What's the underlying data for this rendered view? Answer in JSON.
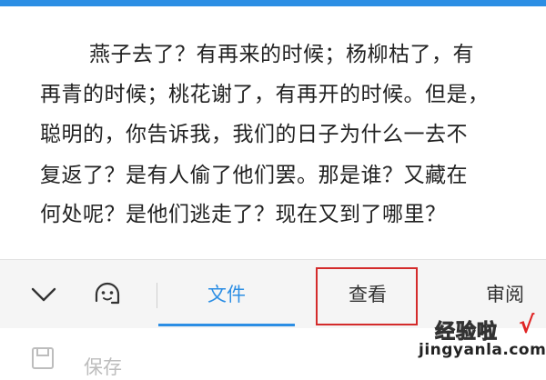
{
  "document": {
    "lines": [
      "燕子去了？有再来的时候；杨柳枯了，有",
      "再青的时候；桃花谢了，有再开的时候。但是，",
      "聪明的，你告诉我，我们的日子为什么一去不",
      "复返了？是有人偷了他们罢。那是谁？又藏在",
      "何处呢？是他们逃走了？现在又到了哪里？"
    ]
  },
  "toolbar": {
    "collapse_icon": "chevron-down-icon",
    "voice_icon": "voice-assistant-icon",
    "tabs": [
      {
        "label": "文件",
        "active": true
      },
      {
        "label": "查看",
        "active": false,
        "highlighted": true
      },
      {
        "label": "审阅",
        "active": false
      }
    ],
    "accent_color": "#2c8ee4",
    "highlight_color": "#d42b2b"
  },
  "bottom": {
    "save_icon": "save-icon",
    "save_label": "保存"
  },
  "watermark": {
    "title": "经验啦",
    "check": "√",
    "url": "jingyanla.com"
  }
}
